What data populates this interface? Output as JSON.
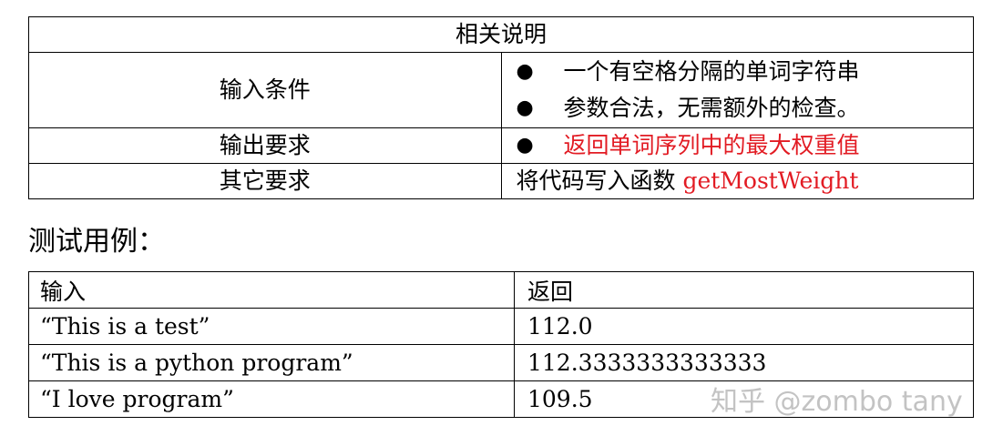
{
  "spec_table": {
    "header": "相关说明",
    "input": {
      "label": "输入条件",
      "items": [
        "一个有空格分隔的单词字符串",
        "参数合法，无需额外的检查。"
      ]
    },
    "output": {
      "label": "输出要求",
      "items": [
        "返回单词序列中的最大权重值"
      ]
    },
    "other": {
      "label": "其它要求",
      "text_prefix": "将代码写入函数 ",
      "function_name": "getMostWeight"
    },
    "bullet_glyph": "●",
    "accent_color": "#e21b23"
  },
  "test_heading": "测试用例：",
  "test_table": {
    "headers": [
      "输入",
      "返回"
    ],
    "rows": [
      [
        "“This is a test”",
        "112.0"
      ],
      [
        "“This is a python program”",
        "112.3333333333333"
      ],
      [
        "“I love program”",
        "109.5"
      ]
    ]
  },
  "watermark": "知乎 @zombo tany"
}
